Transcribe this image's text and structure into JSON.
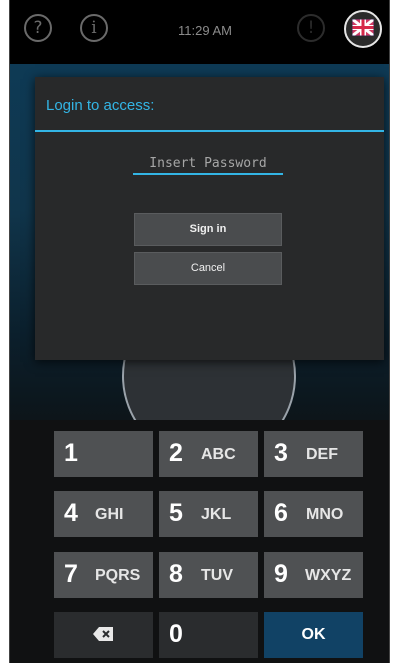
{
  "status_bar": {
    "help_icon_glyph": "?",
    "info_icon_glyph": "i",
    "time": "11:29 AM"
  },
  "dialog": {
    "title": "Login to access:",
    "password_placeholder": "Insert Password",
    "password_value": "",
    "sign_in_label": "Sign in",
    "cancel_label": "Cancel"
  },
  "keypad": {
    "keys": [
      {
        "digit": "1",
        "letters": ""
      },
      {
        "digit": "2",
        "letters": "ABC"
      },
      {
        "digit": "3",
        "letters": "DEF"
      },
      {
        "digit": "4",
        "letters": "GHI"
      },
      {
        "digit": "5",
        "letters": "JKL"
      },
      {
        "digit": "6",
        "letters": "MNO"
      },
      {
        "digit": "7",
        "letters": "PQRS"
      },
      {
        "digit": "8",
        "letters": "TUV"
      },
      {
        "digit": "9",
        "letters": "WXYZ"
      },
      {
        "digit": "0",
        "letters": ""
      }
    ],
    "backspace_icon": "backspace-icon",
    "ok_label": "OK"
  },
  "colors": {
    "accent": "#33b5e5",
    "ok_key": "#114265",
    "key": "#4f5153"
  }
}
